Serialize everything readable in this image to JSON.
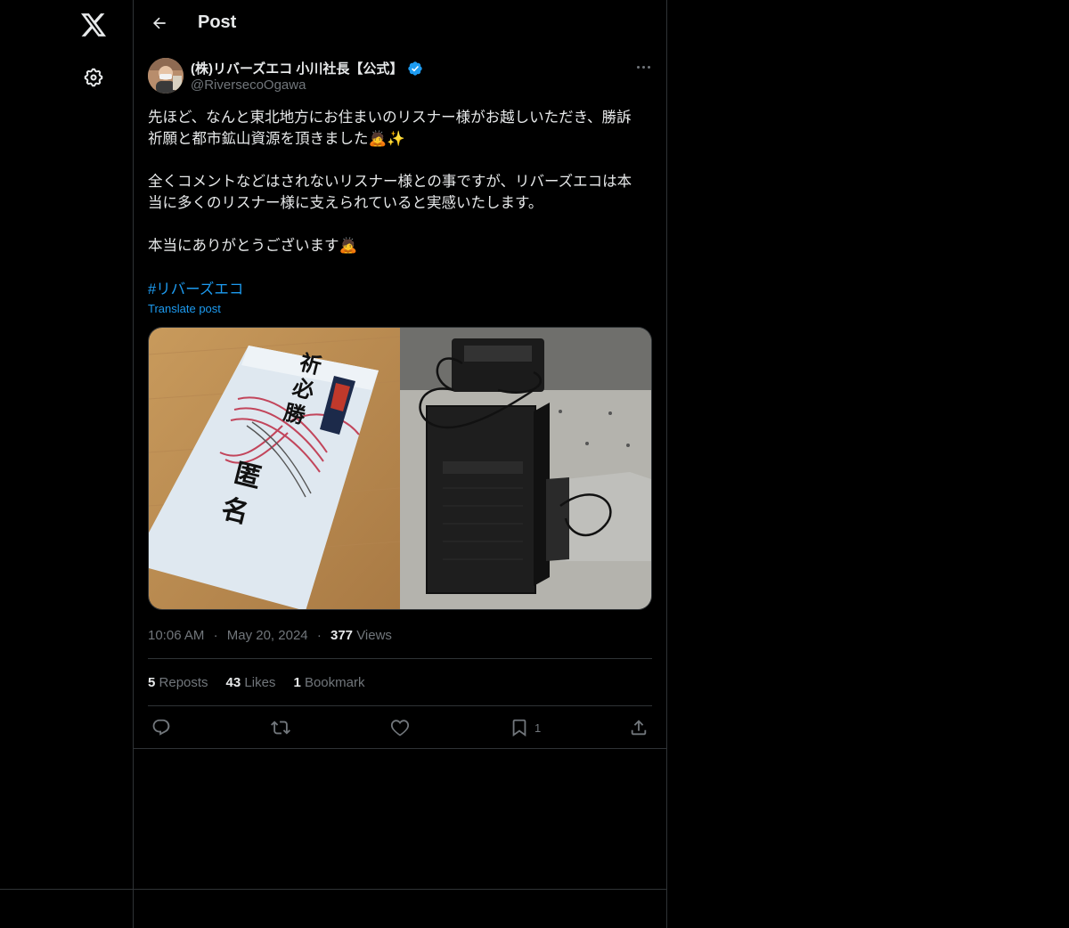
{
  "topbar": {
    "title": "Post"
  },
  "author": {
    "name": "(株)リバーズエコ 小川社長【公式】",
    "handle": "@RiversecoOgawa",
    "verified": true
  },
  "post": {
    "paragraphs": [
      "先ほど、なんと東北地方にお住まいのリスナー様がお越しいただき、勝訴\n祈願と都市鉱山資源を頂きました🙇✨",
      "全くコメントなどはされないリスナー様との事ですが、リバーズエコは本\n当に多くのリスナー様に支えられていると実感いたします。",
      "本当にありがとうございます🙇"
    ],
    "hashtag": "#リバーズエコ",
    "translate_label": "Translate post",
    "images": [
      "envelope-photo",
      "computer-tower-photo"
    ]
  },
  "meta": {
    "time": "10:06 AM",
    "date": "May 20, 2024",
    "views_count": "377",
    "views_label": "Views"
  },
  "stats": {
    "reposts_count": "5",
    "reposts_label": "Reposts",
    "likes_count": "43",
    "likes_label": "Likes",
    "bookmarks_count": "1",
    "bookmarks_label": "Bookmark"
  },
  "actions": {
    "bookmark_count": "1"
  },
  "colors": {
    "background": "#000000",
    "text": "#e7e9ea",
    "muted": "#71767b",
    "accent": "#1d9bf0",
    "border": "#2f3336"
  }
}
